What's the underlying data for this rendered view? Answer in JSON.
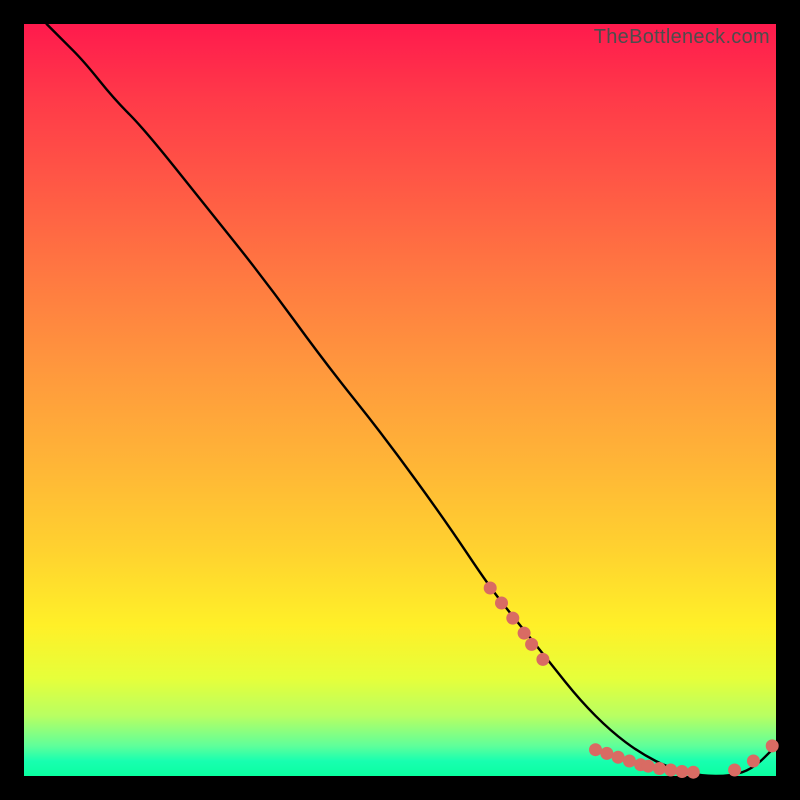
{
  "watermark": "TheBottleneck.com",
  "chart_data": {
    "type": "line",
    "title": "",
    "xlabel": "",
    "ylabel": "",
    "xlim": [
      0,
      100
    ],
    "ylim": [
      0,
      100
    ],
    "grid": false,
    "series": [
      {
        "name": "curve",
        "color": "#000000",
        "marker": false,
        "x_pct": [
          3,
          5,
          8,
          12,
          16,
          24,
          32,
          40,
          48,
          56,
          62,
          66,
          70,
          74,
          78,
          82,
          86,
          90,
          94,
          97,
          100
        ],
        "y_pct": [
          100,
          98,
          95,
          90,
          86,
          76,
          66,
          55,
          45,
          34,
          25,
          20,
          15,
          10,
          6,
          3,
          1,
          0,
          0,
          1,
          4
        ]
      },
      {
        "name": "markers",
        "color": "#d96b63",
        "marker": true,
        "points_pct": [
          [
            62,
            25
          ],
          [
            63.5,
            23
          ],
          [
            65,
            21
          ],
          [
            66.5,
            19
          ],
          [
            67.5,
            17.5
          ],
          [
            69,
            15.5
          ],
          [
            76,
            3.5
          ],
          [
            77.5,
            3
          ],
          [
            79,
            2.5
          ],
          [
            80.5,
            2
          ],
          [
            82,
            1.5
          ],
          [
            83,
            1.3
          ],
          [
            84.5,
            1
          ],
          [
            86,
            0.8
          ],
          [
            87.5,
            0.6
          ],
          [
            89,
            0.5
          ],
          [
            94.5,
            0.8
          ],
          [
            97,
            2
          ],
          [
            99.5,
            4
          ]
        ]
      }
    ]
  }
}
